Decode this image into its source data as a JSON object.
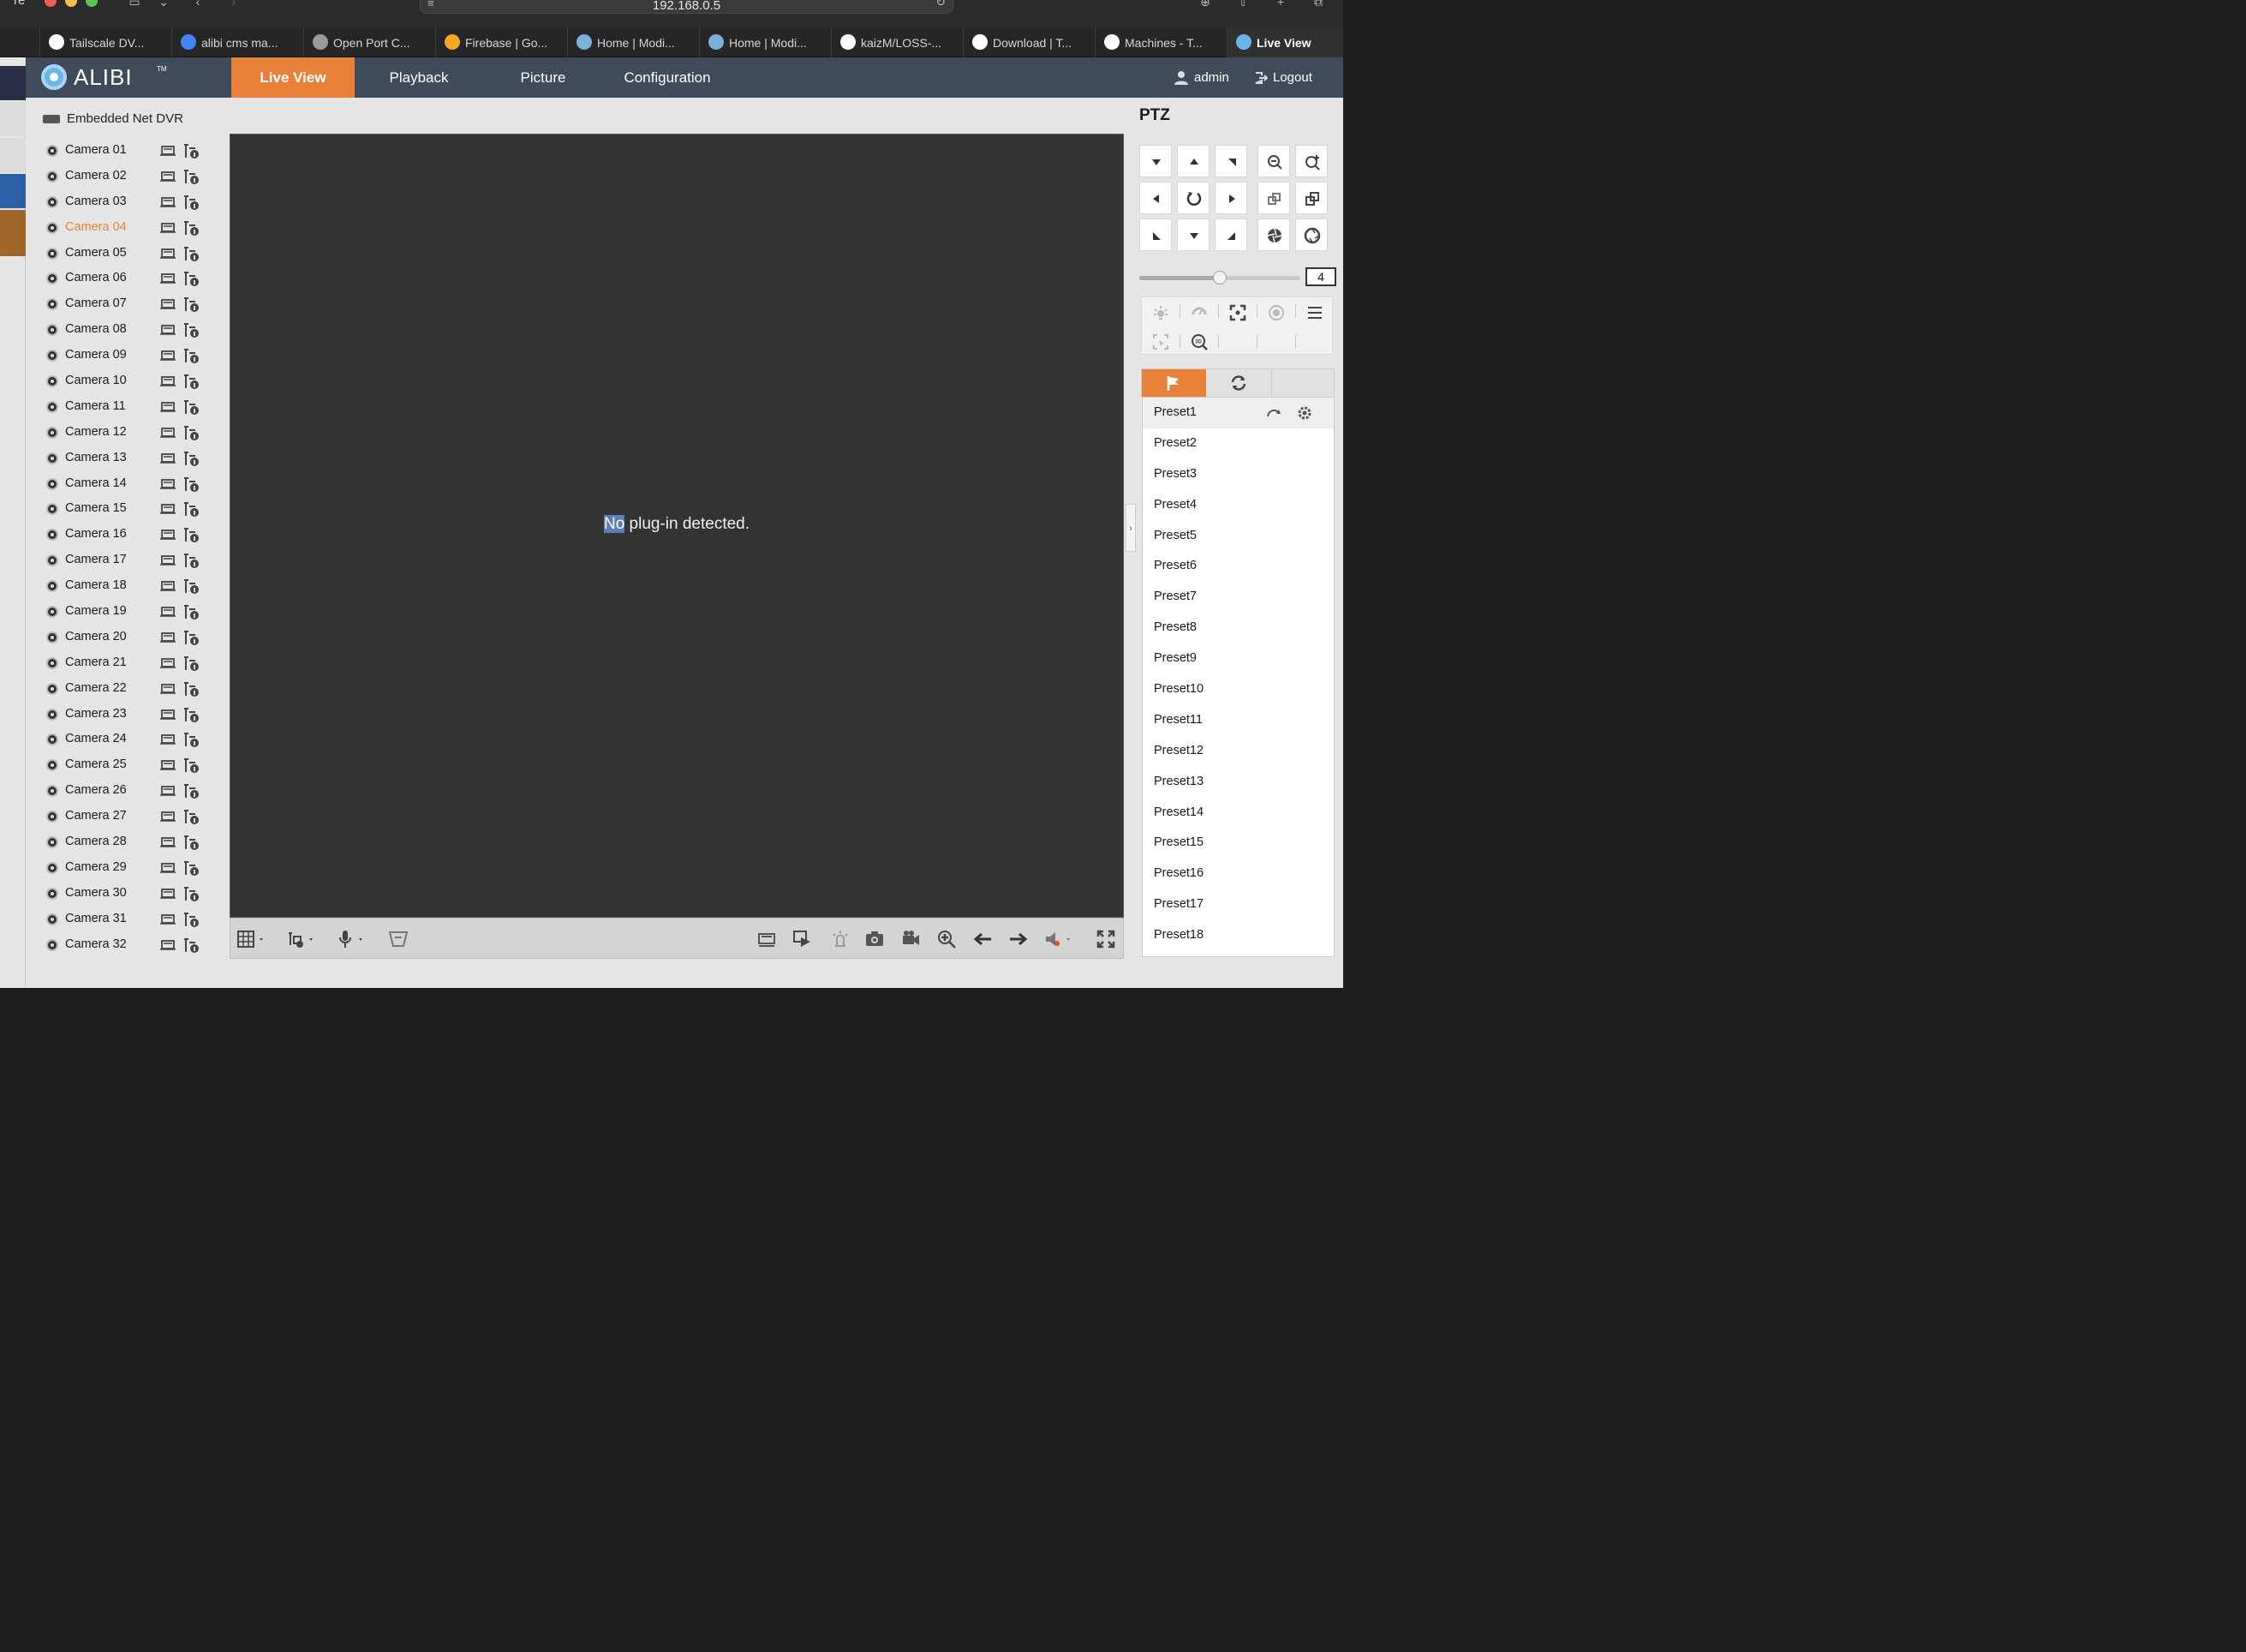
{
  "browser": {
    "url": "192.168.0.5",
    "clipped_left_text": "re",
    "tabs": [
      {
        "label": "Tailscale DV...",
        "icon": "tailscale-icon",
        "color": "#ffffff"
      },
      {
        "label": "alibi cms ma...",
        "icon": "google-icon",
        "color": "#4285f4"
      },
      {
        "label": "Open Port C...",
        "icon": "c-letter-icon",
        "color": "#9a9a9a"
      },
      {
        "label": "Firebase | Go...",
        "icon": "firebase-icon",
        "color": "#f5a623"
      },
      {
        "label": "Home | Modi...",
        "icon": "modi-icon",
        "color": "#7bb0d8"
      },
      {
        "label": "Home | Modi...",
        "icon": "modi-icon",
        "color": "#7bb0d8"
      },
      {
        "label": "kaizM/LOSS-...",
        "icon": "github-icon",
        "color": "#ffffff"
      },
      {
        "label": "Download | T...",
        "icon": "grid-icon",
        "color": "#ffffff"
      },
      {
        "label": "Machines - T...",
        "icon": "dots-icon",
        "color": "#ffffff"
      },
      {
        "label": "Live View",
        "icon": "alibi-icon",
        "color": "#6bb6e8"
      }
    ]
  },
  "app": {
    "brand": "ALIBI",
    "nav": {
      "live_view": "Live View",
      "playback": "Playback",
      "picture": "Picture",
      "configuration": "Configuration"
    },
    "user": "admin",
    "logout": "Logout"
  },
  "tree": {
    "device": "Embedded Net DVR",
    "selected_index": 3,
    "cameras": [
      "Camera 01",
      "Camera 02",
      "Camera 03",
      "Camera 04",
      "Camera 05",
      "Camera 06",
      "Camera 07",
      "Camera 08",
      "Camera 09",
      "Camera 10",
      "Camera 11",
      "Camera 12",
      "Camera 13",
      "Camera 14",
      "Camera 15",
      "Camera 16",
      "Camera 17",
      "Camera 18",
      "Camera 19",
      "Camera 20",
      "Camera 21",
      "Camera 22",
      "Camera 23",
      "Camera 24",
      "Camera 25",
      "Camera 26",
      "Camera 27",
      "Camera 28",
      "Camera 29",
      "Camera 30",
      "Camera 31",
      "Camera 32"
    ]
  },
  "viewer": {
    "message_highlight": "No",
    "message_rest": " plug-in detected."
  },
  "ptz": {
    "title": "PTZ",
    "speed": "4",
    "speed_fraction": 0.5,
    "presets": [
      "Preset1",
      "Preset2",
      "Preset3",
      "Preset4",
      "Preset5",
      "Preset6",
      "Preset7",
      "Preset8",
      "Preset9",
      "Preset10",
      "Preset11",
      "Preset12",
      "Preset13",
      "Preset14",
      "Preset15",
      "Preset16",
      "Preset17",
      "Preset18"
    ]
  },
  "colors": {
    "accent": "#e8823a",
    "nav_bg": "#3f4b5a",
    "viewer_bg": "#333333"
  }
}
